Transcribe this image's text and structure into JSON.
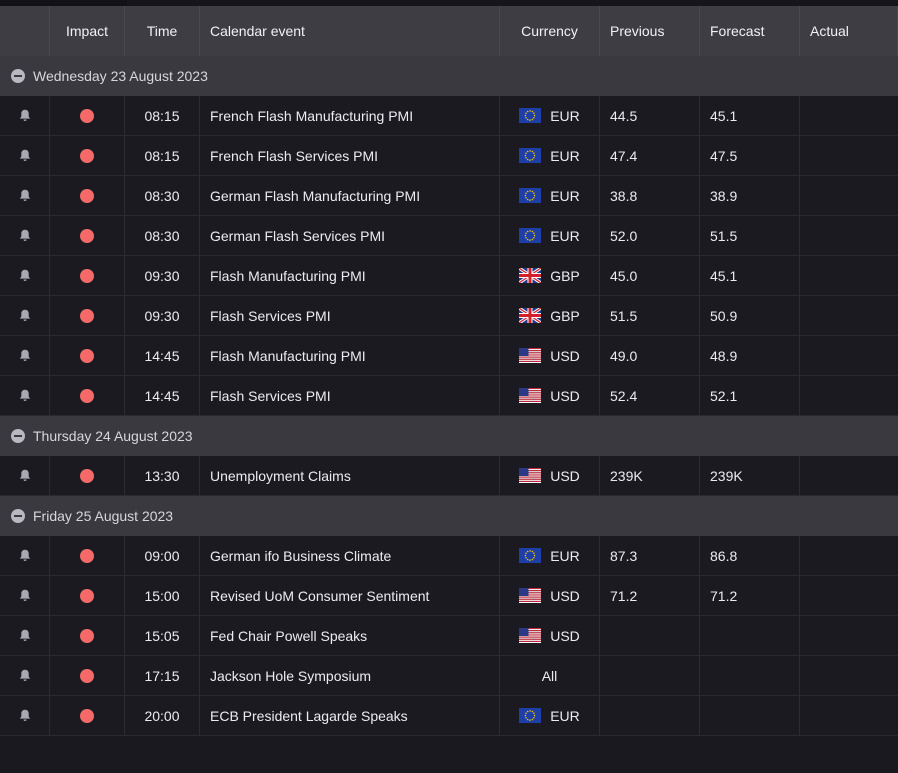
{
  "header": {
    "impact": "Impact",
    "time": "Time",
    "event": "Calendar event",
    "currency": "Currency",
    "previous": "Previous",
    "forecast": "Forecast",
    "actual": "Actual"
  },
  "colors": {
    "impact_high": "#f46a6a",
    "header_bg": "#3e3d44",
    "row_bg": "#1b1a21"
  },
  "groups": [
    {
      "date": "Wednesday 23 August 2023",
      "events": [
        {
          "time": "08:15",
          "event": "French Flash Manufacturing PMI",
          "flag": "eu",
          "currency": "EUR",
          "previous": "44.5",
          "forecast": "45.1",
          "actual": ""
        },
        {
          "time": "08:15",
          "event": "French Flash Services PMI",
          "flag": "eu",
          "currency": "EUR",
          "previous": "47.4",
          "forecast": "47.5",
          "actual": ""
        },
        {
          "time": "08:30",
          "event": "German Flash Manufacturing PMI",
          "flag": "eu",
          "currency": "EUR",
          "previous": "38.8",
          "forecast": "38.9",
          "actual": ""
        },
        {
          "time": "08:30",
          "event": "German Flash Services PMI",
          "flag": "eu",
          "currency": "EUR",
          "previous": "52.0",
          "forecast": "51.5",
          "actual": ""
        },
        {
          "time": "09:30",
          "event": "Flash Manufacturing PMI",
          "flag": "uk",
          "currency": "GBP",
          "previous": "45.0",
          "forecast": "45.1",
          "actual": ""
        },
        {
          "time": "09:30",
          "event": "Flash Services PMI",
          "flag": "uk",
          "currency": "GBP",
          "previous": "51.5",
          "forecast": "50.9",
          "actual": ""
        },
        {
          "time": "14:45",
          "event": "Flash Manufacturing PMI",
          "flag": "us",
          "currency": "USD",
          "previous": "49.0",
          "forecast": "48.9",
          "actual": ""
        },
        {
          "time": "14:45",
          "event": "Flash Services PMI",
          "flag": "us",
          "currency": "USD",
          "previous": "52.4",
          "forecast": "52.1",
          "actual": ""
        }
      ]
    },
    {
      "date": "Thursday 24 August 2023",
      "events": [
        {
          "time": "13:30",
          "event": "Unemployment Claims",
          "flag": "us",
          "currency": "USD",
          "previous": "239K",
          "forecast": "239K",
          "actual": ""
        }
      ]
    },
    {
      "date": "Friday 25 August 2023",
      "events": [
        {
          "time": "09:00",
          "event": "German ifo Business Climate",
          "flag": "eu",
          "currency": "EUR",
          "previous": "87.3",
          "forecast": "86.8",
          "actual": ""
        },
        {
          "time": "15:00",
          "event": "Revised UoM Consumer Sentiment",
          "flag": "us",
          "currency": "USD",
          "previous": "71.2",
          "forecast": "71.2",
          "actual": ""
        },
        {
          "time": "15:05",
          "event": "Fed Chair Powell Speaks",
          "flag": "us",
          "currency": "USD",
          "previous": "",
          "forecast": "",
          "actual": ""
        },
        {
          "time": "17:15",
          "event": "Jackson Hole Symposium",
          "flag": "",
          "currency": "All",
          "previous": "",
          "forecast": "",
          "actual": ""
        },
        {
          "time": "20:00",
          "event": "ECB President Lagarde Speaks",
          "flag": "eu",
          "currency": "EUR",
          "previous": "",
          "forecast": "",
          "actual": ""
        }
      ]
    }
  ]
}
